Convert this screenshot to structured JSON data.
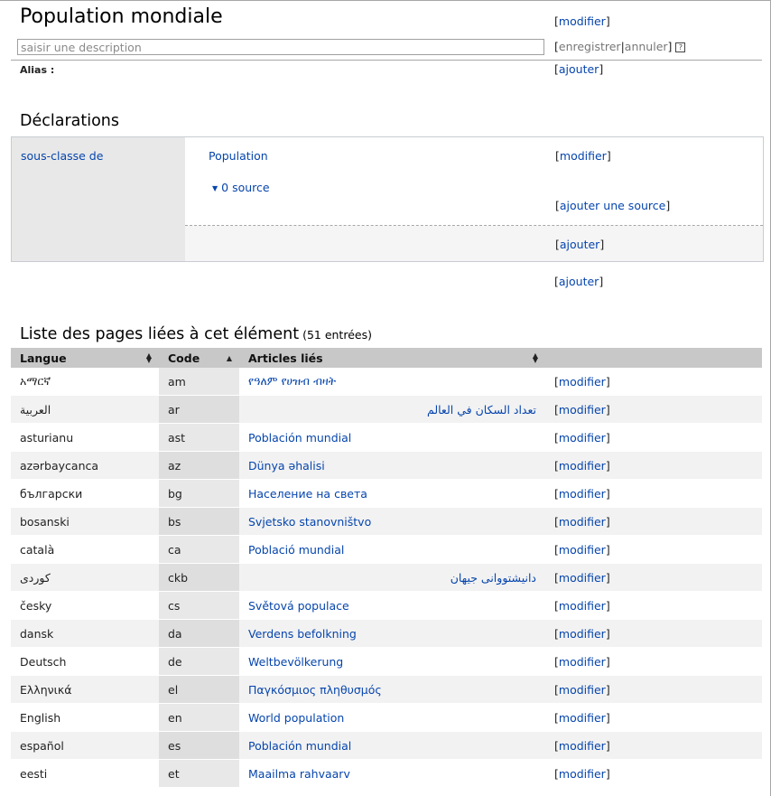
{
  "header": {
    "title": "Population mondiale",
    "edit_label": "modifier",
    "description_placeholder": "saisir une description",
    "save_label": "enregistrer",
    "cancel_label": "annuler",
    "help_icon": "?",
    "alias_label": "Alias :",
    "add_label": "ajouter"
  },
  "declarations": {
    "heading": "Déclarations",
    "property": "sous-classe de",
    "value": "Population",
    "edit_label": "modifier",
    "source_toggle": "0 source",
    "add_source_label": "ajouter une source",
    "add_value_label": "ajouter",
    "add_claim_label": "ajouter"
  },
  "links": {
    "heading": "Liste des pages liées à cet élément",
    "count": "(51 entrées)",
    "columns": [
      "Langue",
      "Code",
      "Articles liés"
    ],
    "edit_label": "modifier",
    "rows": [
      {
        "lang": "አማርኛ",
        "code": "am",
        "article": "የዓለም የሀዝብ ብዛት",
        "rtl": false
      },
      {
        "lang": "العربية",
        "code": "ar",
        "article": "تعداد السكان في العالم",
        "rtl": true
      },
      {
        "lang": "asturianu",
        "code": "ast",
        "article": "Población mundial",
        "rtl": false
      },
      {
        "lang": "azərbaycanca",
        "code": "az",
        "article": "Dünya əhalisi",
        "rtl": false
      },
      {
        "lang": "български",
        "code": "bg",
        "article": "Население на света",
        "rtl": false
      },
      {
        "lang": "bosanski",
        "code": "bs",
        "article": "Svjetsko stanovništvo",
        "rtl": false
      },
      {
        "lang": "català",
        "code": "ca",
        "article": "Població mundial",
        "rtl": false
      },
      {
        "lang": "کوردی",
        "code": "ckb",
        "article": "دانیشتووانی جیھان",
        "rtl": true
      },
      {
        "lang": "česky",
        "code": "cs",
        "article": "Světová populace",
        "rtl": false
      },
      {
        "lang": "dansk",
        "code": "da",
        "article": "Verdens befolkning",
        "rtl": false
      },
      {
        "lang": "Deutsch",
        "code": "de",
        "article": "Weltbevölkerung",
        "rtl": false
      },
      {
        "lang": "Ελληνικά",
        "code": "el",
        "article": "Παγκόσμιος πληθυσμός",
        "rtl": false
      },
      {
        "lang": "English",
        "code": "en",
        "article": "World population",
        "rtl": false
      },
      {
        "lang": "español",
        "code": "es",
        "article": "Población mundial",
        "rtl": false
      },
      {
        "lang": "eesti",
        "code": "et",
        "article": "Maailma rahvaarv",
        "rtl": false
      }
    ]
  }
}
